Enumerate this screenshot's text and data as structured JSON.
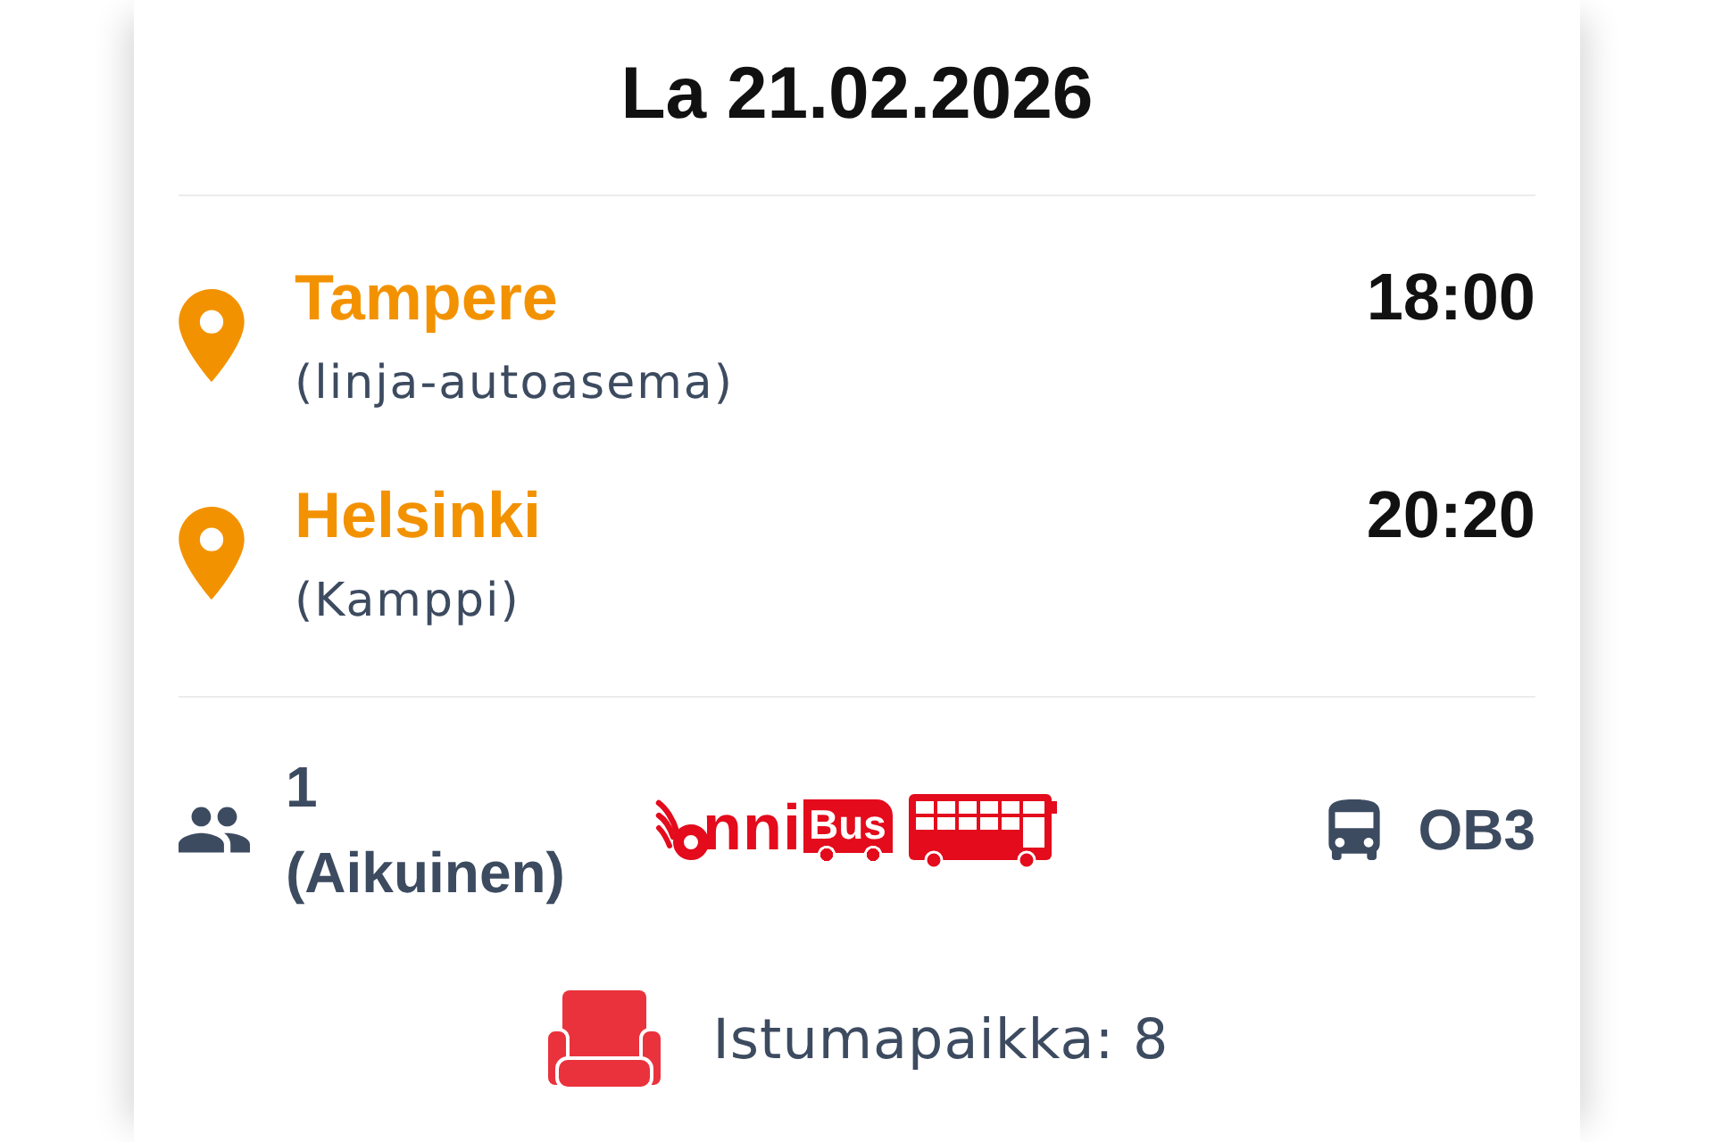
{
  "date": "La 21.02.2026",
  "stops": [
    {
      "city": "Tampere",
      "station": "(linja-autoasema)",
      "time": "18:00"
    },
    {
      "city": "Helsinki",
      "station": "(Kamppi)",
      "time": "20:20"
    }
  ],
  "passengers": {
    "label": "1 (Aikuinen)"
  },
  "operator_logo": {
    "wordmark": "nni",
    "badge": "Bus"
  },
  "line": {
    "code": "OB3"
  },
  "seat": {
    "label": "Istumapaikka: 8"
  }
}
